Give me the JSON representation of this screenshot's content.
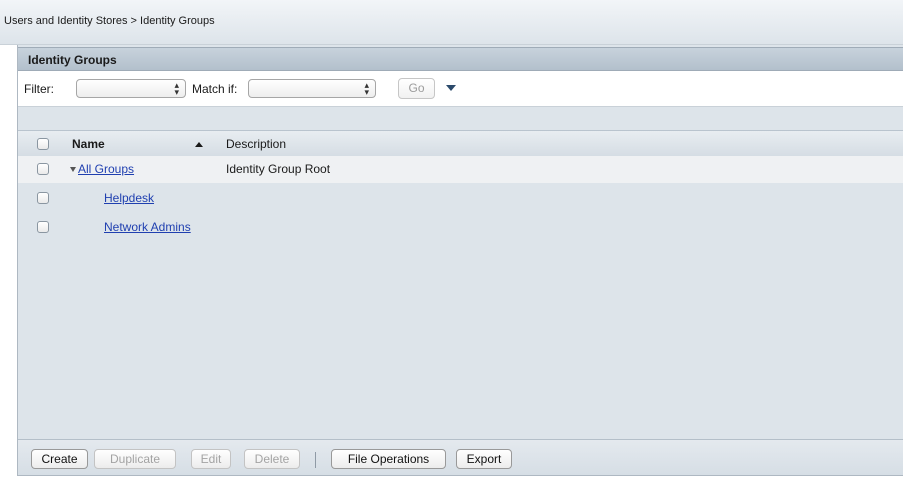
{
  "breadcrumb": "Users and Identity Stores > Identity Groups",
  "panel": {
    "title": "Identity Groups"
  },
  "filter": {
    "filter_label": "Filter:",
    "filter_value": "",
    "match_label": "Match if:",
    "match_value": "",
    "go_label": "Go"
  },
  "table": {
    "columns": [
      "Name",
      "Description"
    ],
    "sort": "ascending",
    "rows": [
      {
        "name": "All Groups",
        "description": "Identity Group Root",
        "expanded": true
      },
      {
        "name": "Helpdesk",
        "description": ""
      },
      {
        "name": "Network Admins",
        "description": ""
      }
    ]
  },
  "toolbar": {
    "create": "Create",
    "duplicate": "Duplicate",
    "edit": "Edit",
    "delete": "Delete",
    "file_operations": "File Operations",
    "export": "Export"
  }
}
